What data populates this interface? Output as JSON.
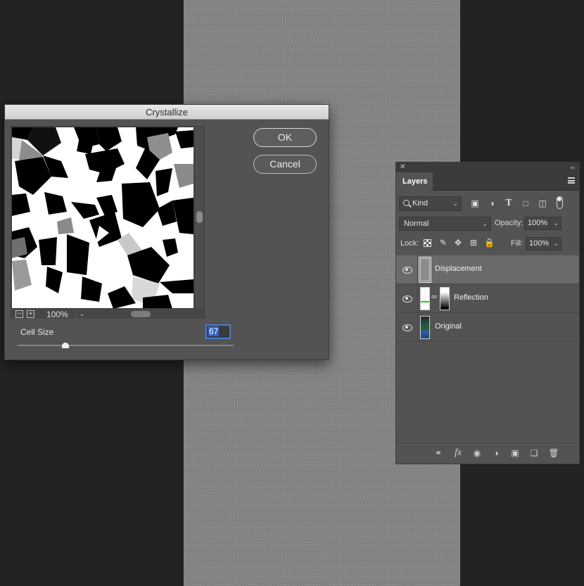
{
  "dialog": {
    "title": "Crystallize",
    "ok_label": "OK",
    "cancel_label": "Cancel",
    "zoom": "100%",
    "zoom_out_symbol": "−",
    "zoom_in_symbol": "+",
    "cell_size_label": "Cell Size",
    "cell_size_value": "67",
    "cell_size_slider_fraction": 0.22
  },
  "layers_panel": {
    "tab_label": "Layers",
    "filter_kind": "Kind",
    "blend_mode": "Normal",
    "opacity_label": "Opacity:",
    "opacity_value": "100%",
    "lock_label": "Lock:",
    "fill_label": "Fill:",
    "fill_value": "100%",
    "layers": [
      {
        "name": "Displacement",
        "selected": true,
        "visible": true
      },
      {
        "name": "Reflection",
        "selected": false,
        "visible": true
      },
      {
        "name": "Original",
        "selected": false,
        "visible": true
      }
    ],
    "footer_icons": [
      "link-layers-icon",
      "fx-icon",
      "add-mask-icon",
      "adjustment-layer-icon",
      "new-group-icon",
      "new-layer-icon",
      "trash-icon"
    ]
  },
  "colors": {
    "background": "#232323",
    "dialog_bg": "#535353",
    "selection_blue": "#4a7ad0"
  }
}
